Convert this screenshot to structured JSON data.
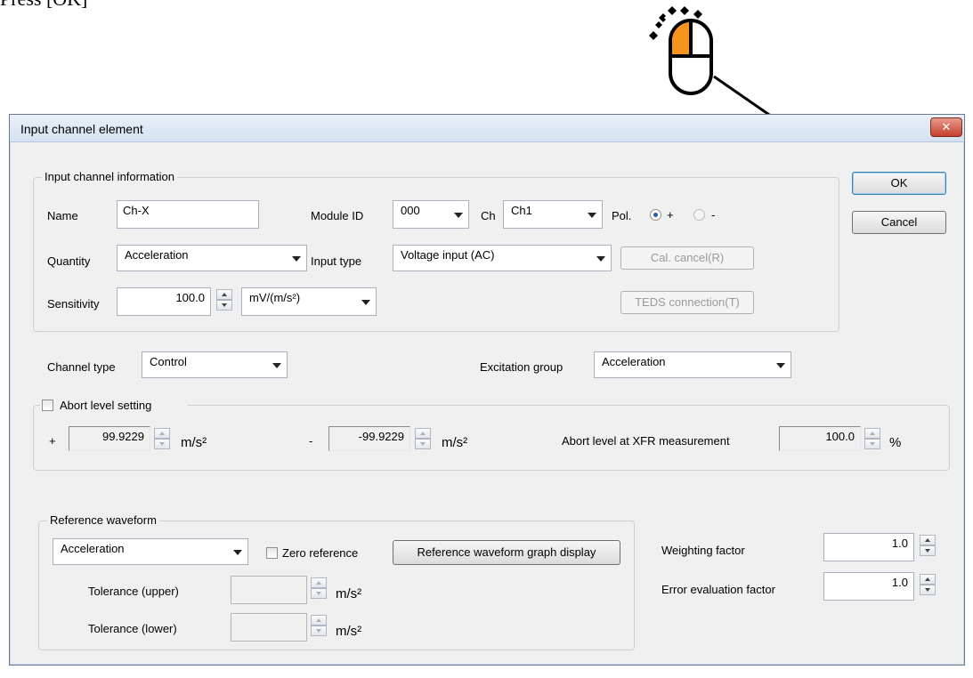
{
  "instruction": "Press [OK]",
  "dialog": {
    "title": "Input channel element",
    "close_label": "✕",
    "ok_label": "OK",
    "cancel_label": "Cancel",
    "info": {
      "group_label": "Input channel information",
      "name_label": "Name",
      "name_value": "Ch-X",
      "module_id_label": "Module ID",
      "module_id_value": "000",
      "ch_label": "Ch",
      "ch_value": "Ch1",
      "pol_label": "Pol.",
      "pol_plus": "+",
      "pol_minus": "-",
      "pol_selected": "+",
      "quantity_label": "Quantity",
      "quantity_value": "Acceleration",
      "input_type_label": "Input type",
      "input_type_value": "Voltage input (AC)",
      "cal_cancel_label": "Cal. cancel(R)",
      "sensitivity_label": "Sensitivity",
      "sensitivity_value": "100.0",
      "sensitivity_unit": "mV/(m/s²)",
      "teds_label": "TEDS connection(T)"
    },
    "channel_type_label": "Channel type",
    "channel_type_value": "Control",
    "excitation_group_label": "Excitation group",
    "excitation_group_value": "Acceleration",
    "abort": {
      "checkbox_label": "Abort level setting",
      "checked": false,
      "plus_sign": "+",
      "plus_value": "99.9229",
      "plus_unit": "m/s²",
      "minus_sign": "-",
      "minus_value": "-99.9229",
      "minus_unit": "m/s²",
      "xfr_label": "Abort level at XFR measurement",
      "xfr_value": "100.0",
      "xfr_unit": "%"
    },
    "reference": {
      "group_label": "Reference waveform",
      "waveform_value": "Acceleration",
      "zero_reference_label": "Zero reference",
      "zero_reference_checked": false,
      "graph_button_label": "Reference waveform graph display",
      "tol_upper_label": "Tolerance (upper)",
      "tol_upper_value": "",
      "tol_upper_unit": "m/s²",
      "tol_lower_label": "Tolerance (lower)",
      "tol_lower_value": "",
      "tol_lower_unit": "m/s²"
    },
    "weighting_factor_label": "Weighting factor",
    "weighting_factor_value": "1.0",
    "error_factor_label": "Error evaluation factor",
    "error_factor_value": "1.0"
  },
  "colors": {
    "mouse_accent": "#f7941d",
    "title_bar": "#dbe6f3",
    "close_button": "#c94a35"
  }
}
